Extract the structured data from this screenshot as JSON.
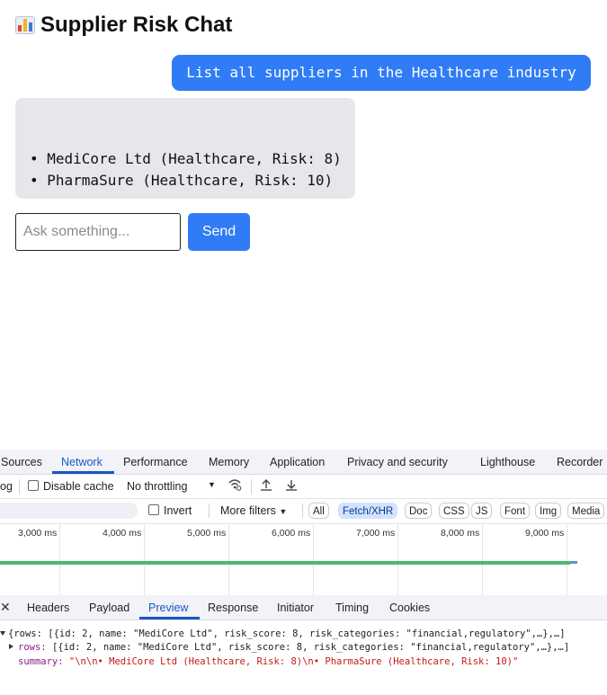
{
  "app": {
    "title": "Supplier Risk Chat",
    "user_message": "List all suppliers in the Healthcare industry",
    "bot_lines": [
      "• MediCore Ltd (Healthcare, Risk: 8)",
      "• PharmaSure (Healthcare, Risk: 10)"
    ],
    "input_placeholder": "Ask something...",
    "send_label": "Send",
    "accent_color": "#2f7cf6"
  },
  "devtools": {
    "tabs": [
      "Sources",
      "Network",
      "Performance",
      "Memory",
      "Application",
      "Privacy and security",
      "Lighthouse",
      "Recorder"
    ],
    "active_tab": "Network",
    "toolbar": {
      "preserve_log_partial": "og",
      "disable_cache": "Disable cache",
      "throttling": "No throttling"
    },
    "filterbar": {
      "invert": "Invert",
      "more_filters": "More filters",
      "types": [
        "All",
        "Fetch/XHR",
        "Doc",
        "CSS",
        "JS",
        "Font",
        "Img",
        "Media"
      ],
      "active_type": "Fetch/XHR"
    },
    "timeline_ticks": [
      "3,000 ms",
      "4,000 ms",
      "5,000 ms",
      "6,000 ms",
      "7,000 ms",
      "8,000 ms",
      "9,000 ms"
    ],
    "detail_tabs": [
      "Headers",
      "Payload",
      "Preview",
      "Response",
      "Initiator",
      "Timing",
      "Cookies"
    ],
    "active_detail_tab": "Preview",
    "preview": {
      "root": "{rows: [{id: 2, name: \"MediCore Ltd\", risk_score: 8, risk_categories: \"financial,regulatory\",…},…]",
      "rows_key": "rows:",
      "rows_value": "[{id: 2, name: \"MediCore Ltd\", risk_score: 8, risk_categories: \"financial,regulatory\",…},…]",
      "summary_key": "summary:",
      "summary_value": "\"\\n\\n• MediCore Ltd (Healthcare, Risk: 8)\\n• PharmaSure (Healthcare, Risk: 10)\""
    }
  }
}
